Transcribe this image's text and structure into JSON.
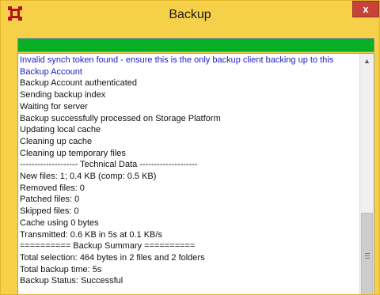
{
  "window": {
    "title": "Backup",
    "close_label": "x"
  },
  "icons": {
    "app": "backup-app-icon",
    "close": "close-icon",
    "scroll_up": "chevron-up-icon",
    "grip": "scrollbar-grip-icon"
  },
  "progress": {
    "value": 1.0
  },
  "log": {
    "lines": [
      "Invalid synch token found - ensure this is the only backup client backing up to this Backup Account",
      "Backup Account authenticated",
      "Sending backup index",
      "Waiting for server",
      "Backup successfully processed on Storage Platform",
      "Updating local cache",
      "Cleaning up cache",
      "Cleaning up temporary files",
      "-------------------- Technical Data --------------------",
      "New files: 1; 0.4 KB (comp: 0.5 KB)",
      "Removed files: 0",
      "Patched files: 0",
      "Skipped files: 0",
      "Cache using 0 bytes",
      "Transmitted: 0.6 KB in 5s at 0.1 KB/s",
      "========== Backup Summary ==========",
      "Total selection: 464 bytes in 2 files and 2 folders",
      "Total backup time: 5s",
      "Backup Status: Successful"
    ]
  },
  "colors": {
    "titlebar": "#f7d04a",
    "close_button": "#c7433a",
    "warning_text": "#1b1bc9",
    "progress_fill": "#06b025"
  }
}
